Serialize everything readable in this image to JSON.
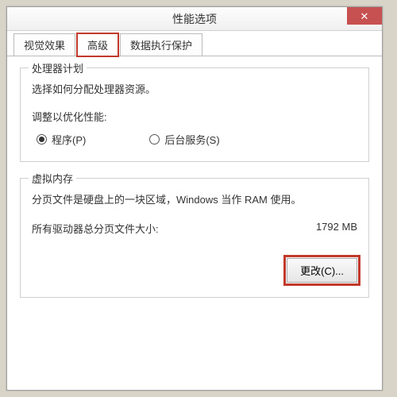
{
  "window": {
    "title": "性能选项",
    "close_glyph": "✕"
  },
  "tabs": [
    {
      "label": "视觉效果"
    },
    {
      "label": "高级"
    },
    {
      "label": "数据执行保护"
    }
  ],
  "cpu_group": {
    "title": "处理器计划",
    "desc": "选择如何分配处理器资源。",
    "subhead": "调整以优化性能:",
    "radio_programs": "程序(P)",
    "radio_services": "后台服务(S)"
  },
  "vm_group": {
    "title": "虚拟内存",
    "desc": "分页文件是硬盘上的一块区域，Windows 当作 RAM 使用。",
    "size_label": "所有驱动器总分页文件大小:",
    "size_value": "1792 MB",
    "change_btn": "更改(C)..."
  }
}
